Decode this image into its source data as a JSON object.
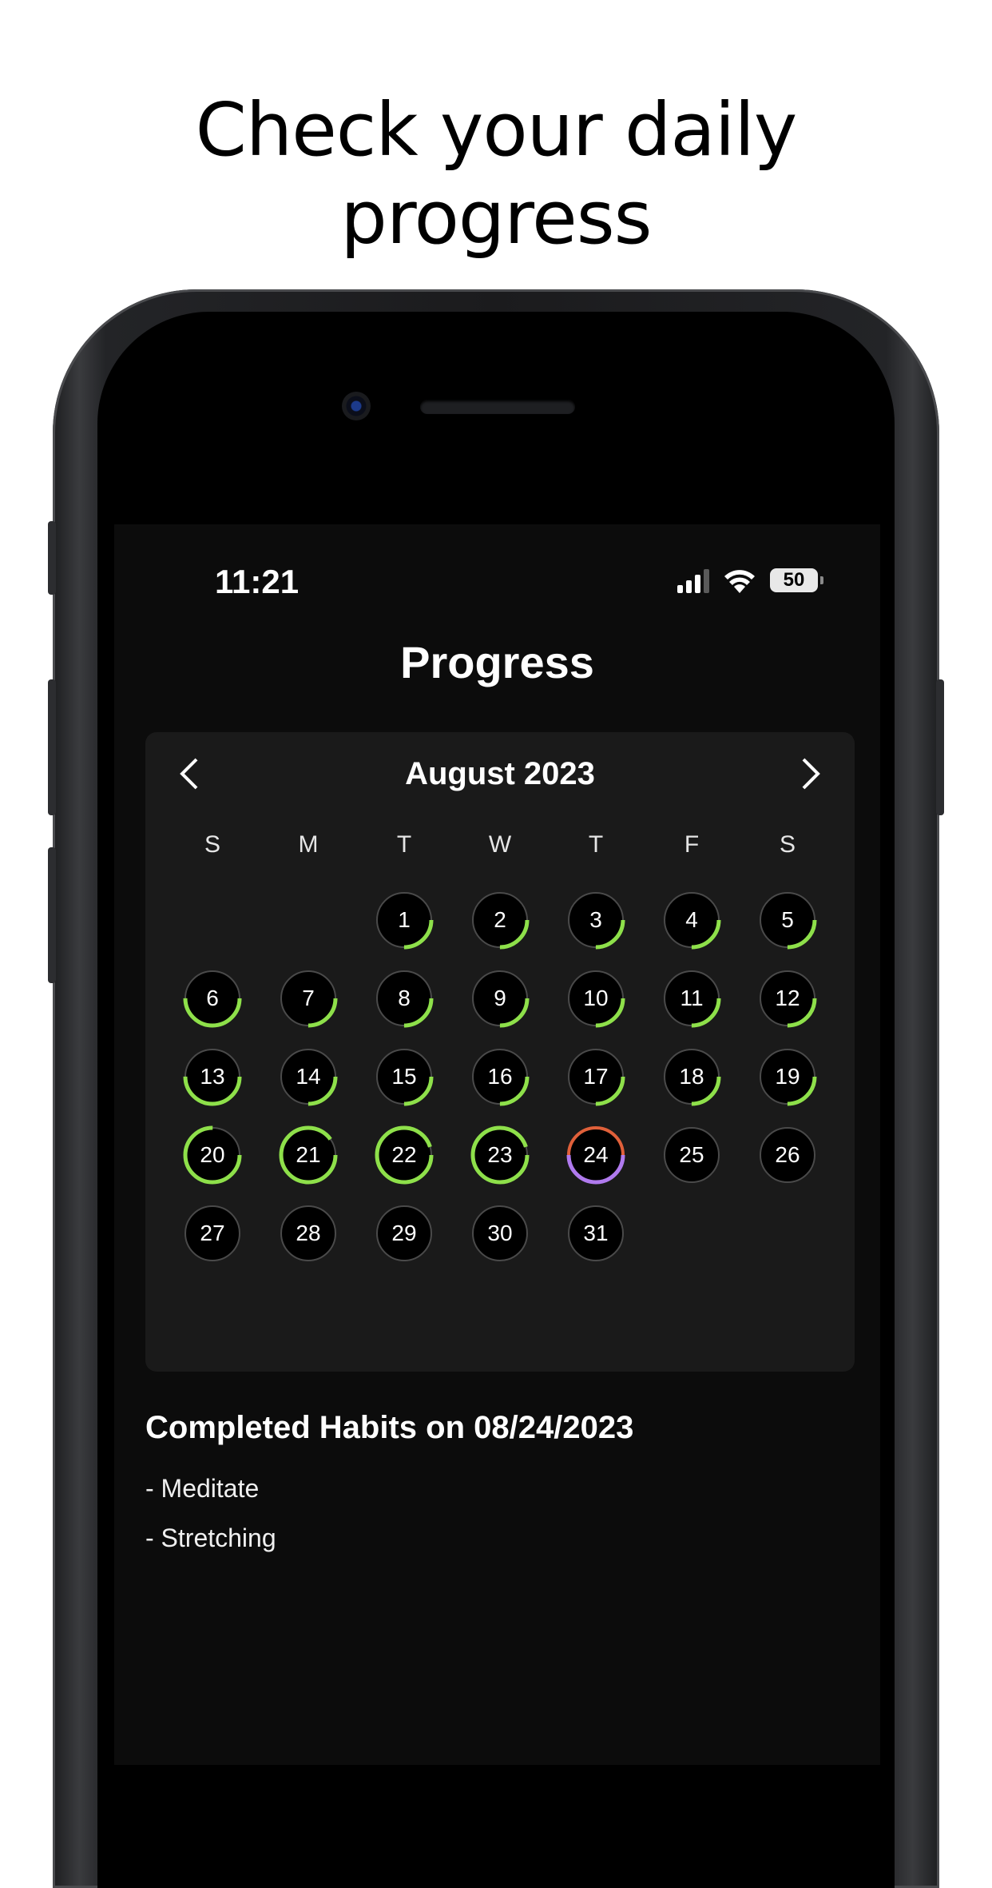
{
  "headline": {
    "line1": "Check your daily",
    "line2": "progress"
  },
  "status_bar": {
    "time": "11:21",
    "battery": "50"
  },
  "page_title": "Progress",
  "calendar": {
    "month_label": "August 2023",
    "prev_icon": "chevron-left-icon",
    "next_icon": "chevron-right-icon",
    "weekdays": [
      "S",
      "M",
      "T",
      "W",
      "T",
      "F",
      "S"
    ],
    "first_weekday_index": 2,
    "days": [
      {
        "day": "1",
        "progress": 0.25
      },
      {
        "day": "2",
        "progress": 0.25
      },
      {
        "day": "3",
        "progress": 0.25
      },
      {
        "day": "4",
        "progress": 0.25
      },
      {
        "day": "5",
        "progress": 0.25
      },
      {
        "day": "6",
        "progress": 0.5
      },
      {
        "day": "7",
        "progress": 0.25
      },
      {
        "day": "8",
        "progress": 0.25
      },
      {
        "day": "9",
        "progress": 0.25
      },
      {
        "day": "10",
        "progress": 0.25
      },
      {
        "day": "11",
        "progress": 0.25
      },
      {
        "day": "12",
        "progress": 0.25
      },
      {
        "day": "13",
        "progress": 0.5
      },
      {
        "day": "14",
        "progress": 0.25
      },
      {
        "day": "15",
        "progress": 0.25
      },
      {
        "day": "16",
        "progress": 0.25
      },
      {
        "day": "17",
        "progress": 0.25
      },
      {
        "day": "18",
        "progress": 0.25
      },
      {
        "day": "19",
        "progress": 0.25
      },
      {
        "day": "20",
        "progress": 0.75
      },
      {
        "day": "21",
        "progress": 0.9
      },
      {
        "day": "22",
        "progress": 0.95
      },
      {
        "day": "23",
        "progress": 0.95
      },
      {
        "day": "24",
        "progress": 1.0,
        "selected": true
      },
      {
        "day": "25",
        "progress": 0
      },
      {
        "day": "26",
        "progress": 0
      },
      {
        "day": "27",
        "progress": 0
      },
      {
        "day": "28",
        "progress": 0
      },
      {
        "day": "29",
        "progress": 0
      },
      {
        "day": "30",
        "progress": 0
      },
      {
        "day": "31",
        "progress": 0
      }
    ],
    "colors": {
      "progress": "#8ee04a",
      "track": "#4a4a4a",
      "selected_top": "#e0603a",
      "selected_bottom": "#b07aee",
      "day_fill": "#000000"
    }
  },
  "completed": {
    "title": "Completed Habits on 08/24/2023",
    "items": [
      "- Meditate",
      "- Stretching"
    ]
  }
}
